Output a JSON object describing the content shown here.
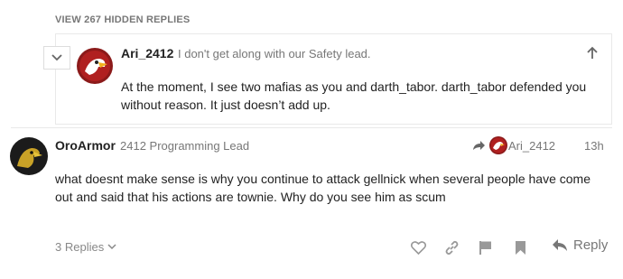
{
  "hidden_replies": {
    "label": "VIEW 267 HIDDEN REPLIES"
  },
  "embedded_post": {
    "username": "Ari_2412",
    "title": "I don't get along with our Safety lead.",
    "body": "At the moment, I see two mafias as you and darth_tabor. darth_tabor defended you without reason. It just doesn’t add up.",
    "icons": {
      "collapse": "chevron-down-icon",
      "jump": "arrow-up-icon"
    }
  },
  "post": {
    "username": "OroArmor",
    "title": "2412 Programming Lead",
    "reply_to": {
      "username": "Ari_2412",
      "icon": "reply-arrow-icon"
    },
    "timestamp": "13h",
    "body": "what doesnt make sense is why you continue to attack gellnick when several people have come out and said that his actions are townie. Why do you see him as scum"
  },
  "footer": {
    "replies_label": "3 Replies",
    "reply_label": "Reply",
    "icons": [
      "heart-icon",
      "link-icon",
      "flag-icon",
      "bookmark-icon",
      "reply-icon"
    ]
  },
  "colors": {
    "muted": "#777777",
    "text": "#222222",
    "border": "#e9e9e9",
    "icon": "#999999"
  }
}
